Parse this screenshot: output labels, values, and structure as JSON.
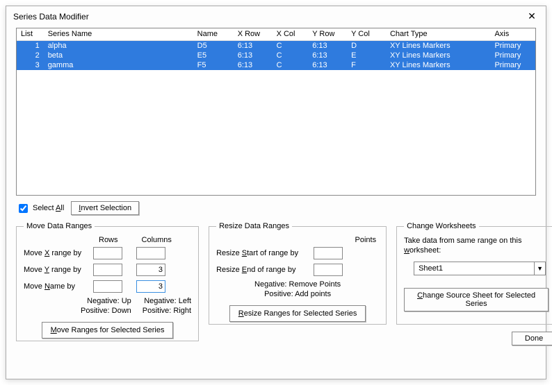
{
  "window": {
    "title": "Series Data Modifier"
  },
  "columns": {
    "list": "List",
    "series": "Series Name",
    "name": "Name",
    "xrow": "X Row",
    "xcol": "X Col",
    "yrow": "Y Row",
    "ycol": "Y Col",
    "chart": "Chart Type",
    "axis": "Axis"
  },
  "rows": [
    {
      "list": "1",
      "series": "alpha",
      "name": "D5",
      "xrow": "6:13",
      "xcol": "C",
      "yrow": "6:13",
      "ycol": "D",
      "chart": "XY Lines Markers",
      "axis": "Primary"
    },
    {
      "list": "2",
      "series": "beta",
      "name": "E5",
      "xrow": "6:13",
      "xcol": "C",
      "yrow": "6:13",
      "ycol": "E",
      "chart": "XY Lines Markers",
      "axis": "Primary"
    },
    {
      "list": "3",
      "series": "gamma",
      "name": "F5",
      "xrow": "6:13",
      "xcol": "C",
      "yrow": "6:13",
      "ycol": "F",
      "chart": "XY Lines Markers",
      "axis": "Primary"
    }
  ],
  "select_all": {
    "label_pre": "Select ",
    "label_u": "A",
    "label_post": "ll",
    "checked": true
  },
  "invert": {
    "label_u": "I",
    "label_post": "nvert Selection"
  },
  "move": {
    "legend": "Move Data Ranges",
    "hdr_rows": "Rows",
    "hdr_cols": "Columns",
    "x_pre": "Move ",
    "x_u": "X",
    "x_post": " range by",
    "x_rows": "",
    "x_cols": "",
    "y_pre": "Move ",
    "y_u": "Y",
    "y_post": " range by",
    "y_rows": "",
    "y_cols": "3",
    "n_pre": "Move ",
    "n_u": "N",
    "n_post": "ame by",
    "n_rows": "",
    "n_cols": "3",
    "note1": "Negative: Up\nPositive: Down",
    "note2": "Negative: Left\nPositive: Right",
    "btn_u": "M",
    "btn_post": "ove Ranges for Selected Series"
  },
  "resize": {
    "legend": "Resize Data Ranges",
    "hdr_points": "Points",
    "s_pre": "Resize ",
    "s_u": "S",
    "s_post": "tart of range by",
    "s_val": "",
    "e_pre": "Resize ",
    "e_u": "E",
    "e_post": "nd of range by",
    "e_val": "",
    "note": "Negative: Remove Points\nPositive: Add points",
    "btn_u": "R",
    "btn_post": "esize Ranges for Selected Series"
  },
  "change": {
    "legend": "Change Worksheets",
    "text_pre": "Take data from same range on this ",
    "text_u": "w",
    "text_post": "orksheet:",
    "sheet": "Sheet1",
    "btn_u": "C",
    "btn_post": "hange Source Sheet for Selected Series"
  },
  "done": "Done"
}
